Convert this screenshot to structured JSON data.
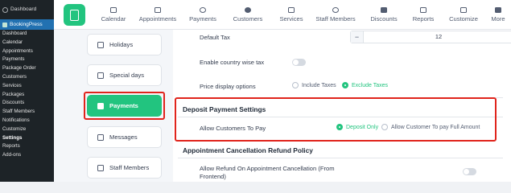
{
  "wp_menu": {
    "dashboard": "Dashboard",
    "plugin": "BookingPress",
    "items": [
      "Dashboard",
      "Calendar",
      "Appointments",
      "Payments",
      "Package Order",
      "Customers",
      "Services",
      "Packages",
      "Discounts",
      "Staff Members",
      "Notifications",
      "Customize",
      "Settings",
      "Reports",
      "Add-ons"
    ]
  },
  "topnav": {
    "items": [
      "Calendar",
      "Appointments",
      "Payments",
      "Customers",
      "Services",
      "Staff Members",
      "Discounts",
      "Reports",
      "Customize",
      "More"
    ]
  },
  "settings_menu": {
    "holidays": "Holidays",
    "special_days": "Special days",
    "payments": "Payments",
    "messages": "Messages",
    "staff_members": "Staff Members"
  },
  "form": {
    "default_tax_label": "Default Tax",
    "default_tax_value": "12",
    "minus": "−",
    "plus": "+",
    "pct": "%",
    "country_tax_label": "Enable country wise tax",
    "price_display_label": "Price display options",
    "include_taxes": "Include Taxes",
    "exclude_taxes": "Exclude Taxes",
    "deposit_title": "Deposit Payment Settings",
    "allow_pay_label": "Allow Customers To Pay",
    "deposit_only": "Deposit Only",
    "full_amount": "Allow Customer To pay Full Amount",
    "refund_title": "Appointment Cancellation Refund Policy",
    "refund_label": "Allow Refund On Appointment Cancellation (From Frontend)"
  },
  "colors": {
    "accent": "#22c47f",
    "highlight": "#e0241c",
    "wp_dark": "#1d2327",
    "wp_blue": "#2271b1"
  }
}
